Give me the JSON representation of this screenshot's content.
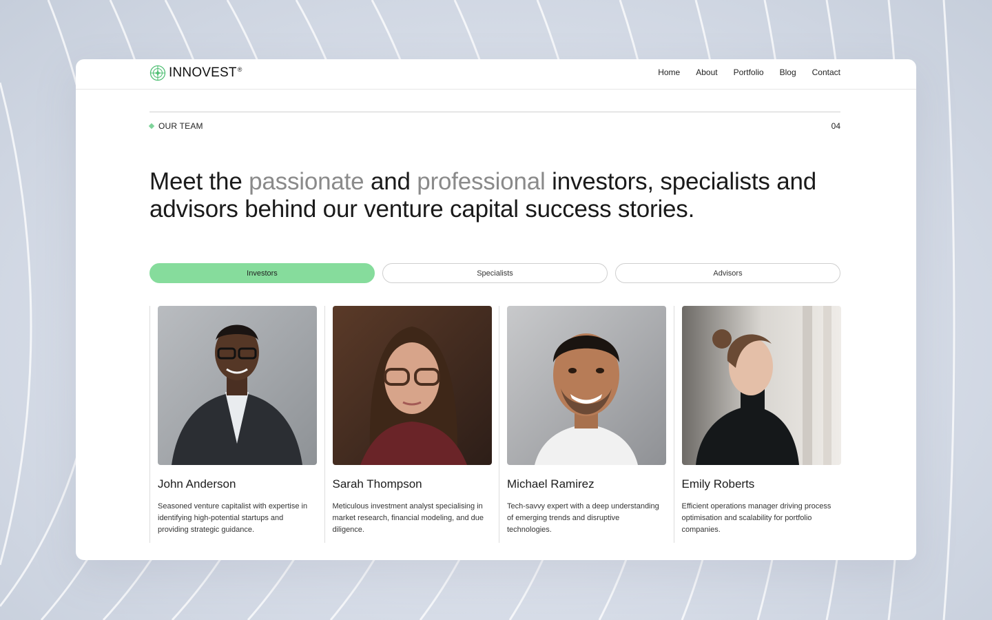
{
  "brand": {
    "name": "INNOVEST",
    "reg": "®",
    "accent": "#86dc9c"
  },
  "nav": {
    "links": [
      "Home",
      "About",
      "Portfolio",
      "Blog",
      "Contact"
    ]
  },
  "section": {
    "label": "OUR TEAM",
    "number": "04"
  },
  "headline": {
    "part1": "Meet the ",
    "muted1": "passionate",
    "part2": " and ",
    "muted2": "professional",
    "part3": " investors, specialists and advisors behind our venture capital success stories."
  },
  "tabs": [
    {
      "label": "Investors",
      "active": true
    },
    {
      "label": "Specialists",
      "active": false
    },
    {
      "label": "Advisors",
      "active": false
    }
  ],
  "team": [
    {
      "name": "John Anderson",
      "bio": "Seasoned venture capitalist with expertise in identifying high-potential startups and providing strategic guidance."
    },
    {
      "name": "Sarah Thompson",
      "bio": "Meticulous investment analyst specialising in market research, financial modeling, and due diligence."
    },
    {
      "name": "Michael Ramirez",
      "bio": "Tech-savvy expert with a deep understanding of emerging trends and disruptive technologies."
    },
    {
      "name": "Emily Roberts",
      "bio": "Efficient operations manager driving process optimisation and scalability for portfolio companies."
    }
  ]
}
